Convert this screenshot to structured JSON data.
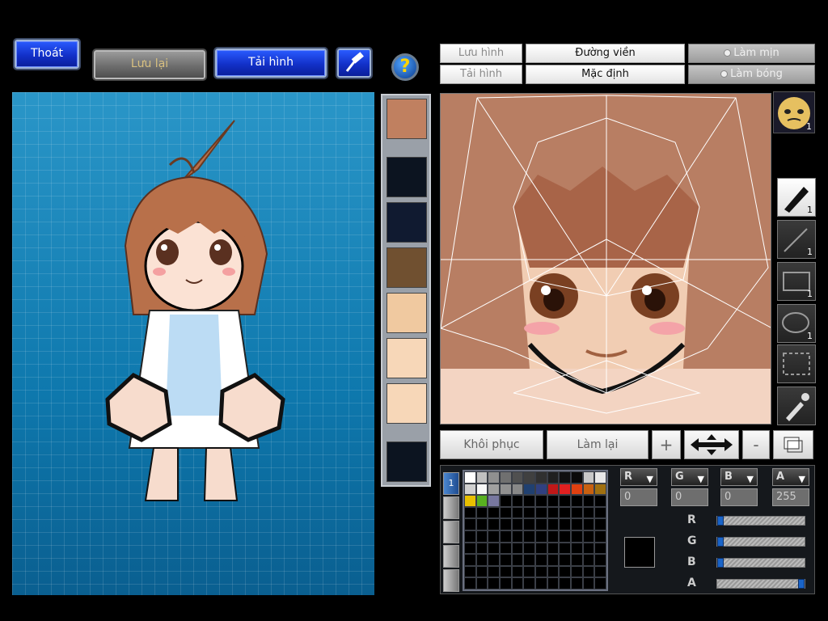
{
  "toolbar": {
    "exit_label": "Thoát",
    "save_label": "Lưu lại",
    "load_label": "Tải hình",
    "help_label": "?"
  },
  "editor_header": {
    "save_image": "Lưu hình",
    "load_image": "Tải hình",
    "outline": "Đường viền",
    "default": "Mặc định",
    "smooth": "Làm mịn",
    "shade": "Làm bóng"
  },
  "tools": {
    "pen_count": "1",
    "line_count": "1",
    "rect_count": "1",
    "ellipse_count": "1",
    "avatar_badge": "1"
  },
  "actions": {
    "restore": "Khôi phục",
    "redo": "Làm lại",
    "zoom_in": "+",
    "zoom_out": "-"
  },
  "palette": {
    "tab_label": "1",
    "colors": [
      "#ffffff",
      "#c0c0c0",
      "#909090",
      "#707070",
      "#505050",
      "#404040",
      "#303030",
      "#202020",
      "#101010",
      "#0a0a0a",
      "#c8c8c8",
      "#e8e8e8",
      "#d0d0d0",
      "#f8f8f8",
      "#a0a0a0",
      "#909090",
      "#888888",
      "#204070",
      "#304080",
      "#c01818",
      "#e02020",
      "#e04010",
      "#c86010",
      "#a07010",
      "#e8c000",
      "#58b020",
      "#7878a0"
    ]
  },
  "channels": {
    "r_label": "R",
    "g_label": "G",
    "b_label": "B",
    "a_label": "A",
    "r": "0",
    "g": "0",
    "b": "0",
    "a": "255"
  },
  "sliders": {
    "r": 0,
    "g": 0,
    "b": 0,
    "a": 1
  }
}
